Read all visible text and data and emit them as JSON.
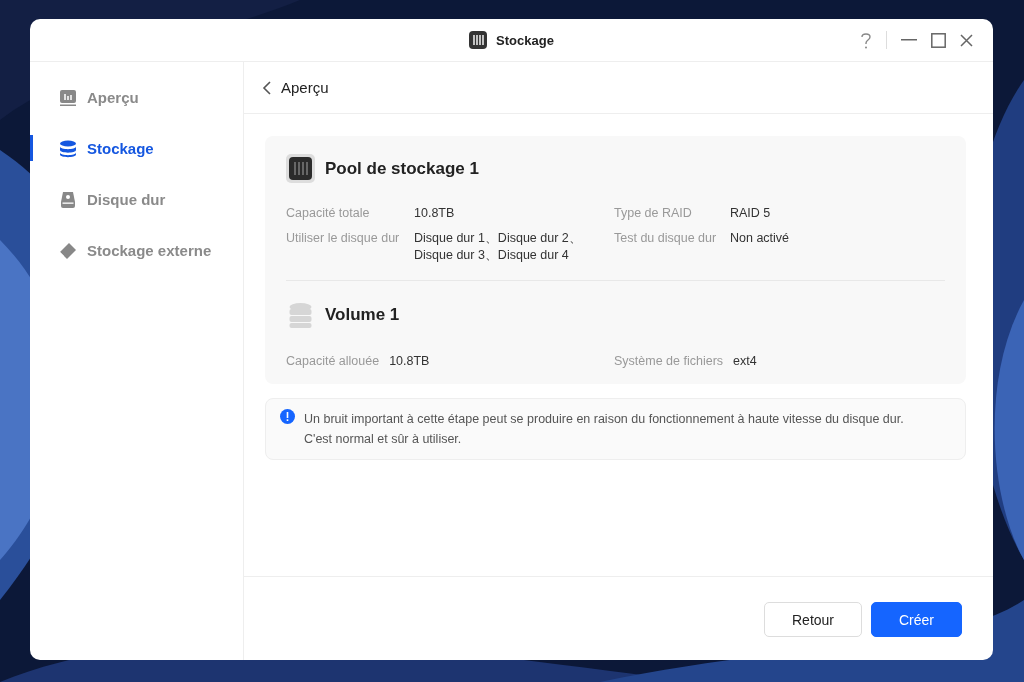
{
  "window": {
    "title": "Stockage"
  },
  "sidebar": {
    "items": [
      {
        "label": "Aperçu",
        "kind": "overview",
        "selected": false
      },
      {
        "label": "Stockage",
        "kind": "storage",
        "selected": true
      },
      {
        "label": "Disque dur",
        "kind": "disk",
        "selected": false
      },
      {
        "label": "Stockage externe",
        "kind": "external",
        "selected": false
      }
    ]
  },
  "header": {
    "title": "Aperçu"
  },
  "pool": {
    "title": "Pool de stockage 1",
    "fields": [
      {
        "label": "Capacité totale",
        "value": "10.8TB"
      },
      {
        "label": "Type de RAID",
        "value": "RAID 5"
      },
      {
        "label": "Utiliser le disque dur",
        "value": "Disque dur 1、Disque dur 2、Disque dur 3、Disque dur 4"
      },
      {
        "label": "Test du disque dur",
        "value": "Non activé"
      }
    ]
  },
  "volume": {
    "title": "Volume 1",
    "fields": [
      {
        "label": "Capacité allouée",
        "value": "10.8TB"
      },
      {
        "label": "Système de fichiers",
        "value": "ext4"
      }
    ]
  },
  "notice": {
    "text": "Un bruit important à cette étape peut se produire en raison du fonctionnement à haute vitesse du disque dur. C'est normal et sûr à utiliser."
  },
  "buttons": [
    {
      "label": "Retour",
      "kind": "secondary"
    },
    {
      "label": "Créer",
      "kind": "primary"
    }
  ]
}
